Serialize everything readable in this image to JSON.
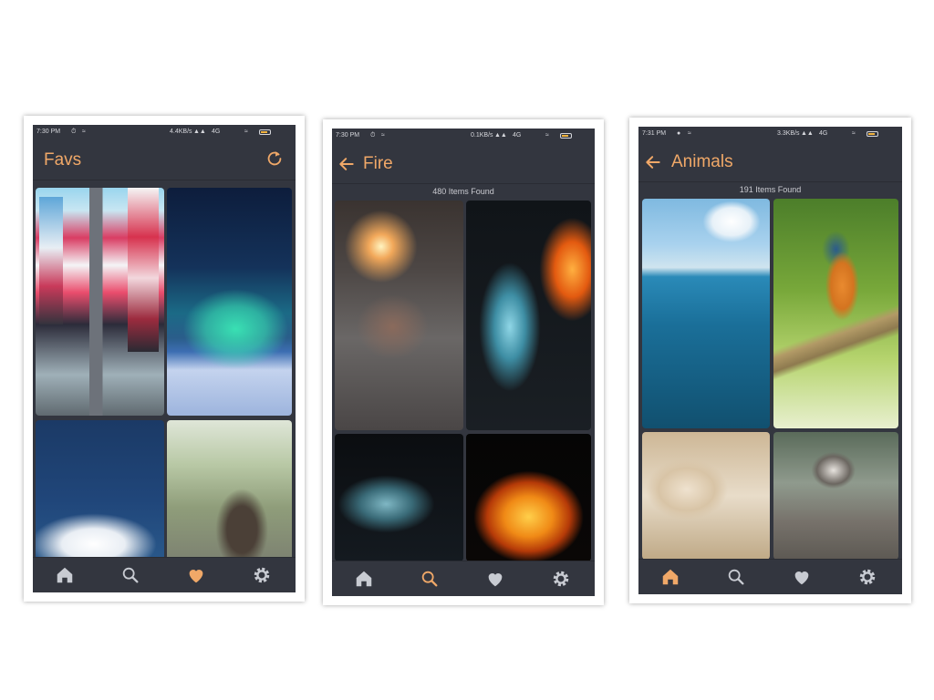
{
  "screens": [
    {
      "status": {
        "time": "7:30 PM",
        "speed": "4.4KB/s",
        "network": "4G"
      },
      "title": "Favs",
      "found": ""
    },
    {
      "status": {
        "time": "7:30 PM",
        "speed": "0.1KB/s",
        "network": "4G"
      },
      "title": "Fire",
      "found": "480 Items Found"
    },
    {
      "status": {
        "time": "7:31 PM",
        "speed": "3.3KB/s",
        "network": "4G"
      },
      "title": "Animals",
      "found": "191 Items Found"
    }
  ],
  "nav": {
    "items": [
      "home-icon",
      "search-icon",
      "heart-icon",
      "settings-icon"
    ],
    "active": [
      "heart-icon",
      "search-icon",
      "home-icon"
    ]
  },
  "colors": {
    "background": "#33363f",
    "accent": "#f0a868",
    "icon": "#c8cbd2"
  }
}
